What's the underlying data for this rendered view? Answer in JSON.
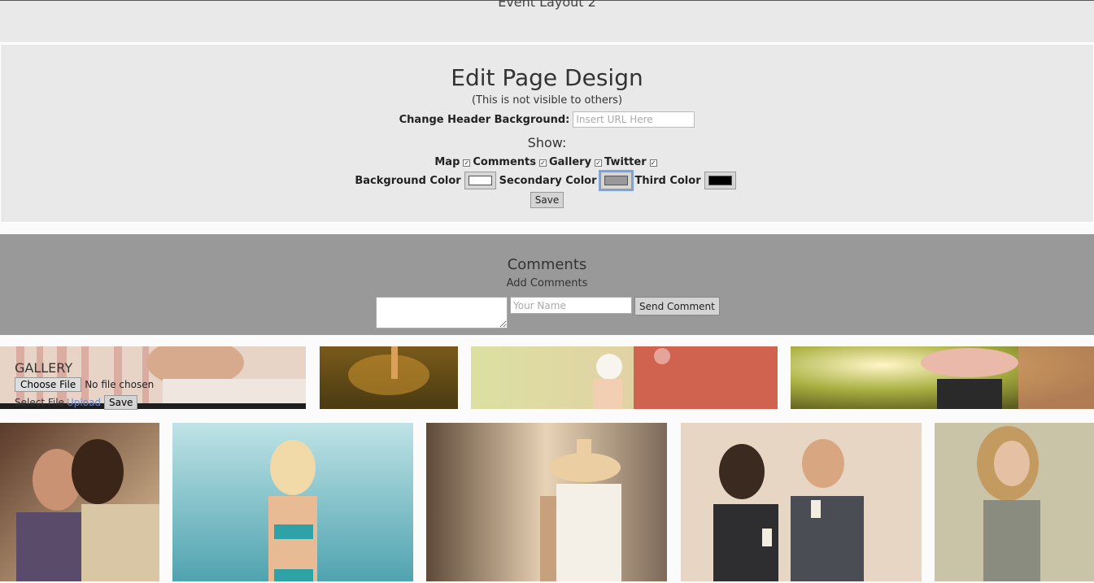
{
  "header": {
    "event_title": "Event Layout 2"
  },
  "design": {
    "title": "Edit Page Design",
    "note": "(This is not visible to others)",
    "header_bg_label": "Change Header Background:",
    "header_bg_placeholder": "Insert URL Here",
    "show_label": "Show:",
    "toggles": [
      {
        "label": "Map",
        "checked": true
      },
      {
        "label": "Comments",
        "checked": true
      },
      {
        "label": "Gallery",
        "checked": true
      },
      {
        "label": "Twitter",
        "checked": true
      }
    ],
    "colors": {
      "background_label": "Background Color",
      "background_value": "#ffffff",
      "secondary_label": "Secondary Color",
      "secondary_value": "#999999",
      "third_label": "Third Color",
      "third_value": "#000000"
    },
    "save_label": "Save"
  },
  "comments": {
    "title": "Comments",
    "add_label": "Add Comments",
    "name_placeholder": "Your Name",
    "send_label": "Send Comment"
  },
  "gallery": {
    "title": "GALLERY",
    "choose_label": "Choose File",
    "no_file": "No file chosen",
    "select_label": "Select File",
    "upload_label": "Upload",
    "save_label": "Save"
  }
}
